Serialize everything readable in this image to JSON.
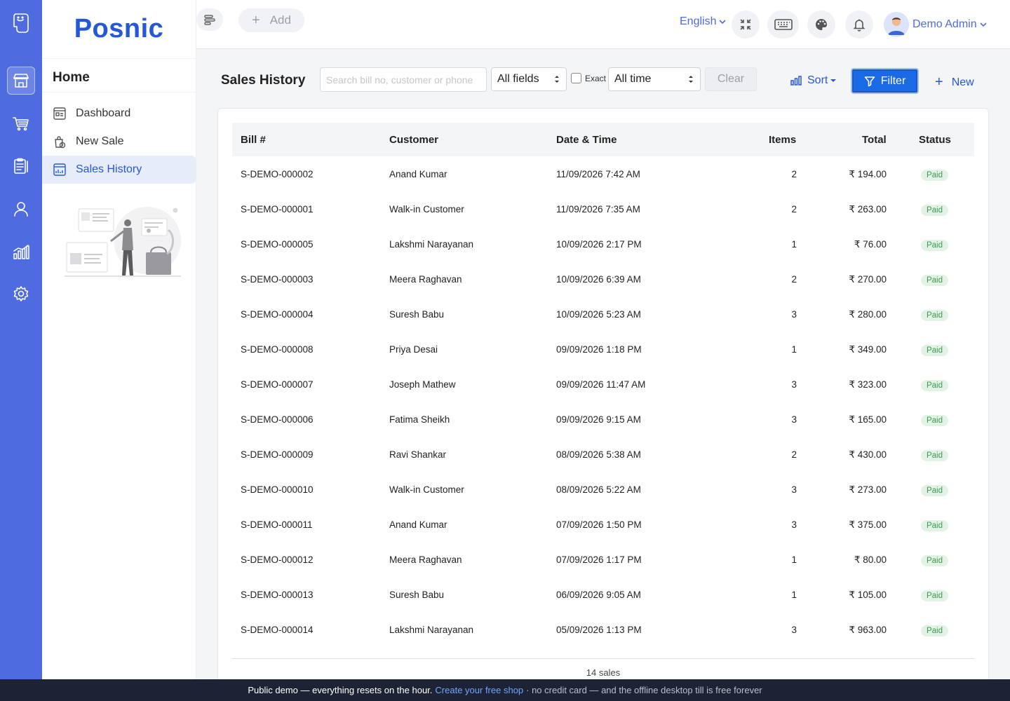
{
  "brand": "Posnic",
  "sidebar": {
    "title": "Home",
    "items": [
      {
        "label": "Dashboard",
        "icon": "dashboard-icon"
      },
      {
        "label": "New Sale",
        "icon": "new-sale-icon"
      },
      {
        "label": "Sales History",
        "icon": "sales-history-icon",
        "active": true
      }
    ]
  },
  "rail": [
    "store-icon",
    "cart-icon",
    "clipboard-icon",
    "user-icon",
    "chart-icon",
    "gear-icon"
  ],
  "topbar": {
    "add_label": "Add",
    "language": "English",
    "user_name": "Demo Admin"
  },
  "toolbar": {
    "title": "Sales History",
    "search_placeholder": "Search bill no, customer or phone",
    "field_select": "All fields",
    "exact_label": "Exact",
    "time_select": "All time",
    "clear_label": "Clear",
    "sort_label": "Sort",
    "filter_label": "Filter",
    "new_label": "New"
  },
  "table": {
    "columns": [
      "Bill #",
      "Customer",
      "Date & Time",
      "Items",
      "Total",
      "Status"
    ],
    "rows": [
      {
        "bill": "S-DEMO-000002",
        "customer": "Anand Kumar",
        "datetime": "11/09/2026 7:42 AM",
        "items": "2",
        "total": "₹ 194.00",
        "status": "Paid"
      },
      {
        "bill": "S-DEMO-000001",
        "customer": "Walk-in Customer",
        "datetime": "11/09/2026 7:35 AM",
        "items": "2",
        "total": "₹ 263.00",
        "status": "Paid"
      },
      {
        "bill": "S-DEMO-000005",
        "customer": "Lakshmi Narayanan",
        "datetime": "10/09/2026 2:17 PM",
        "items": "1",
        "total": "₹ 76.00",
        "status": "Paid"
      },
      {
        "bill": "S-DEMO-000003",
        "customer": "Meera Raghavan",
        "datetime": "10/09/2026 6:39 AM",
        "items": "2",
        "total": "₹ 270.00",
        "status": "Paid"
      },
      {
        "bill": "S-DEMO-000004",
        "customer": "Suresh Babu",
        "datetime": "10/09/2026 5:23 AM",
        "items": "3",
        "total": "₹ 280.00",
        "status": "Paid"
      },
      {
        "bill": "S-DEMO-000008",
        "customer": "Priya Desai",
        "datetime": "09/09/2026 1:18 PM",
        "items": "1",
        "total": "₹ 349.00",
        "status": "Paid"
      },
      {
        "bill": "S-DEMO-000007",
        "customer": "Joseph Mathew",
        "datetime": "09/09/2026 11:47 AM",
        "items": "3",
        "total": "₹ 323.00",
        "status": "Paid"
      },
      {
        "bill": "S-DEMO-000006",
        "customer": "Fatima Sheikh",
        "datetime": "09/09/2026 9:15 AM",
        "items": "3",
        "total": "₹ 165.00",
        "status": "Paid"
      },
      {
        "bill": "S-DEMO-000009",
        "customer": "Ravi Shankar",
        "datetime": "08/09/2026 5:38 AM",
        "items": "2",
        "total": "₹ 430.00",
        "status": "Paid"
      },
      {
        "bill": "S-DEMO-000010",
        "customer": "Walk-in Customer",
        "datetime": "08/09/2026 5:22 AM",
        "items": "3",
        "total": "₹ 273.00",
        "status": "Paid"
      },
      {
        "bill": "S-DEMO-000011",
        "customer": "Anand Kumar",
        "datetime": "07/09/2026 1:50 PM",
        "items": "3",
        "total": "₹ 375.00",
        "status": "Paid"
      },
      {
        "bill": "S-DEMO-000012",
        "customer": "Meera Raghavan",
        "datetime": "07/09/2026 1:17 PM",
        "items": "1",
        "total": "₹ 80.00",
        "status": "Paid"
      },
      {
        "bill": "S-DEMO-000013",
        "customer": "Suresh Babu",
        "datetime": "06/09/2026 9:05 AM",
        "items": "1",
        "total": "₹ 105.00",
        "status": "Paid"
      },
      {
        "bill": "S-DEMO-000014",
        "customer": "Lakshmi Narayanan",
        "datetime": "05/09/2026 1:13 PM",
        "items": "3",
        "total": "₹ 963.00",
        "status": "Paid"
      }
    ],
    "footer_count": "14 sales"
  },
  "banner": {
    "lead": "Public demo — everything resets on the hour.",
    "link": "Create your free shop",
    "tail": "· no credit card — and the offline desktop till is free forever"
  },
  "colors": {
    "rail": "#4e6be0",
    "accent": "#2458d6",
    "filter": "#1a6ae6",
    "paid_bg": "#e2f3e5",
    "paid_text": "#3c9a52",
    "banner": "#1d2334"
  }
}
